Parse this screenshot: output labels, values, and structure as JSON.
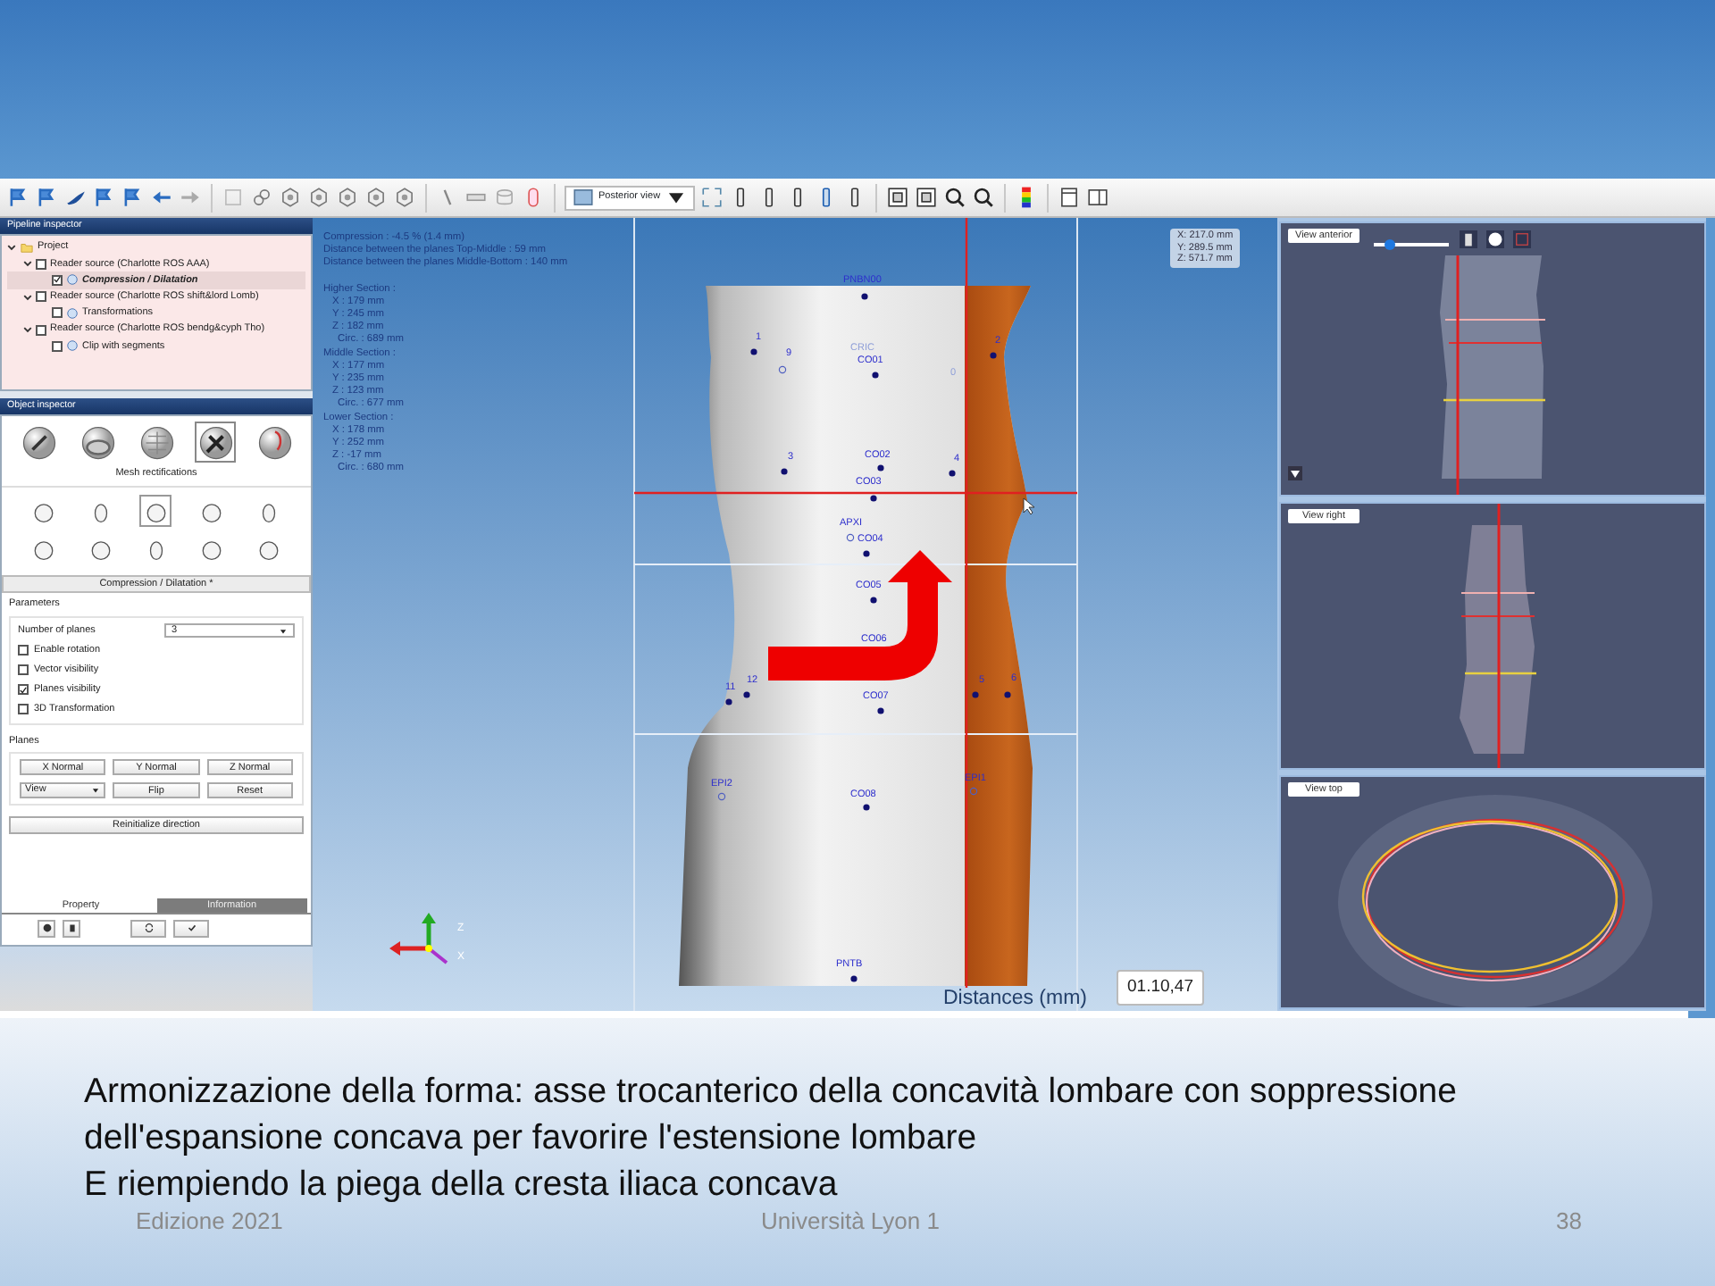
{
  "toolbar": {
    "view_select": "Posterior view"
  },
  "pipeline_inspector": {
    "title": "Pipeline inspector",
    "tree": [
      {
        "label": "Project",
        "selected": false,
        "expanded": true,
        "children": [
          {
            "label": "Reader source (Charlotte ROS AAA)",
            "checked": false,
            "selected": false,
            "expanded": true,
            "children": [
              {
                "label": "Compression / Dilatation",
                "checked": true,
                "selected": true
              }
            ]
          },
          {
            "label": "Reader source (Charlotte ROS shift&lord Lomb)",
            "checked": false,
            "selected": false,
            "expanded": true,
            "children": [
              {
                "label": "Transformations",
                "checked": false,
                "selected": false
              }
            ]
          },
          {
            "label": "Reader source (Charlotte ROS bendg&cyph Tho)",
            "checked": false,
            "selected": false,
            "expanded": true,
            "children": [
              {
                "label": "Clip with segments",
                "checked": false,
                "selected": false
              }
            ]
          }
        ]
      }
    ]
  },
  "object_inspector": {
    "title": "Object inspector",
    "categories": [
      {
        "selected": false
      },
      {
        "selected": false
      },
      {
        "selected": false
      },
      {
        "selected": true
      },
      {
        "selected": false
      }
    ],
    "category_label": "Mesh rectifications",
    "tools": [
      {
        "selected": false
      },
      {
        "selected": false
      },
      {
        "selected": true
      },
      {
        "selected": false
      },
      {
        "selected": false
      },
      {
        "selected": false
      },
      {
        "selected": false
      },
      {
        "selected": false
      },
      {
        "selected": false
      },
      {
        "selected": false
      }
    ],
    "panel_title": "Compression / Dilatation *",
    "parameters": {
      "legend": "Parameters",
      "planes_label": "Number of planes",
      "planes_value": "3",
      "options": [
        {
          "label": "Enable rotation",
          "checked": false
        },
        {
          "label": "Vector visibility",
          "checked": false
        },
        {
          "label": "Planes visibility",
          "checked": true
        },
        {
          "label": "3D Transformation",
          "checked": false
        }
      ]
    },
    "planes": {
      "legend": "Planes",
      "axis_buttons": [
        "X Normal",
        "Y Normal",
        "Z Normal"
      ],
      "view_select": "View",
      "action_buttons": [
        "Flip",
        "Reset"
      ]
    },
    "reinitialize_button": "Reinitialize direction",
    "tabs": [
      {
        "label": "Property",
        "selected": true
      },
      {
        "label": "Information",
        "selected": false
      }
    ]
  },
  "viewport": {
    "summary": [
      "Compression : -4.5 % (1.4 mm)",
      "Distance between the planes Top-Middle : 59 mm",
      "Distance between the planes Middle-Bottom : 140 mm"
    ],
    "sections": [
      {
        "title": "Higher Section :",
        "values": [
          "X : 179 mm",
          "Y : 245 mm",
          "Z : 182 mm",
          "Circ. : 689 mm"
        ]
      },
      {
        "title": "Middle Section :",
        "values": [
          "X : 177 mm",
          "Y : 235 mm",
          "Z : 123 mm",
          "Circ. : 677 mm"
        ]
      },
      {
        "title": "Lower Section :",
        "values": [
          "X : 178 mm",
          "Y : 252 mm",
          "Z : -17 mm",
          "Circ. : 680 mm"
        ]
      }
    ],
    "coordinates": [
      "X: 217.0 mm",
      "Y: 289.5 mm",
      "Z: 571.7 mm"
    ],
    "landmarks": [
      "PNBN00",
      "1",
      "9",
      "CRIC",
      "CO01",
      "0",
      "2",
      "3",
      "CO02",
      "4",
      "CO03",
      "APXI",
      "CO04",
      "CO05",
      "CO06",
      "11",
      "12",
      "CO07",
      "5",
      "6",
      "EPI2",
      "CO08",
      "EPI1",
      "PNTB"
    ],
    "axis_labels": [
      "Z",
      "X"
    ],
    "legend_title": "Distances (mm)",
    "tooltip": "01.10,47"
  },
  "side_views": [
    {
      "label": "View anterior",
      "kind": "anterior",
      "slider": {
        "level": 0.22
      }
    },
    {
      "label": "View right",
      "kind": "right"
    },
    {
      "label": "View top",
      "kind": "top"
    }
  ],
  "caption": [
    "Armonizzazione della forma: asse trocanterico della concavità lombare con soppressione dell'espansione concava per favorire l'estensione lombare",
    "E riempiendo la piega della cresta iliaca concava"
  ],
  "footer": {
    "left": "Edizione 2021",
    "center": "Università Lyon 1",
    "page": "38"
  }
}
